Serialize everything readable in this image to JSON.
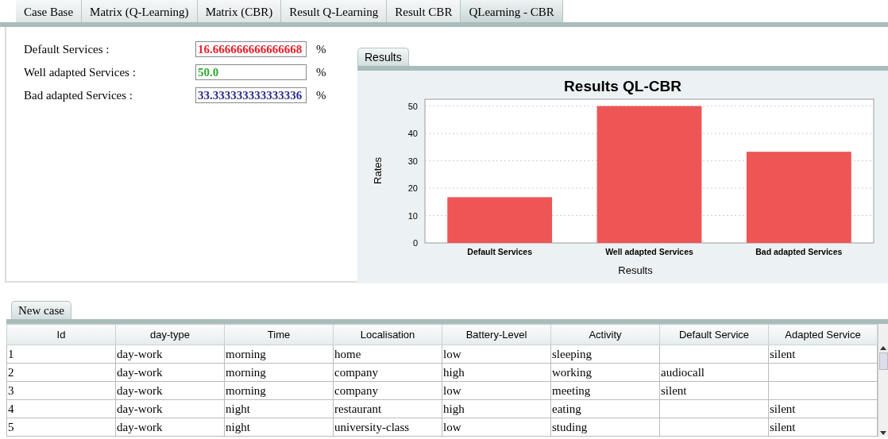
{
  "tabs": [
    {
      "label": "Case Base",
      "selected": false
    },
    {
      "label": "Matrix (Q-Learning)",
      "selected": false
    },
    {
      "label": "Matrix (CBR)",
      "selected": false
    },
    {
      "label": "Result Q-Learning",
      "selected": false
    },
    {
      "label": "Result CBR",
      "selected": false
    },
    {
      "label": "QLearning - CBR",
      "selected": true
    }
  ],
  "fields": [
    {
      "label": "Default Services  :",
      "value": "16.666666666666668",
      "color": "#e8202a",
      "unit": "%"
    },
    {
      "label": "Well adapted Services :",
      "value": "50.0",
      "color": "#2fa82f",
      "unit": "%"
    },
    {
      "label": "Bad adapted Services :",
      "value": "33.333333333333336",
      "color": "#2b2e8c",
      "unit": "%"
    }
  ],
  "results_panel": {
    "tab": "Results",
    "chart_data": {
      "type": "bar",
      "title": "Results QL-CBR",
      "xlabel": "Results",
      "ylabel": "Rates",
      "categories": [
        "Default Services",
        "Well adapted Services",
        "Bad adapted Services"
      ],
      "values": [
        16.7,
        50,
        33.3
      ],
      "grid": true,
      "ylim": [
        0,
        52.5
      ],
      "yticks": [
        0,
        10,
        20,
        30,
        40,
        50
      ]
    }
  },
  "case_panel": {
    "tab": "New case",
    "columns": [
      "Id",
      "day-type",
      "Time",
      "Localisation",
      "Battery-Level",
      "Activity",
      "Default Service",
      "Adapted Service"
    ],
    "rows": [
      [
        "1",
        "day-work",
        "morning",
        "home",
        "low",
        "sleeping",
        "",
        "silent"
      ],
      [
        "2",
        "day-work",
        "morning",
        "company",
        "high",
        "working",
        "audiocall",
        ""
      ],
      [
        "3",
        "day-work",
        "morning",
        "company",
        "low",
        "meeting",
        "silent",
        ""
      ],
      [
        "4",
        "day-work",
        "night",
        "restaurant",
        "high",
        "eating",
        "",
        "silent"
      ],
      [
        "5",
        "day-work",
        "night",
        "university-class",
        "low",
        "studing",
        "",
        "silent"
      ]
    ]
  }
}
